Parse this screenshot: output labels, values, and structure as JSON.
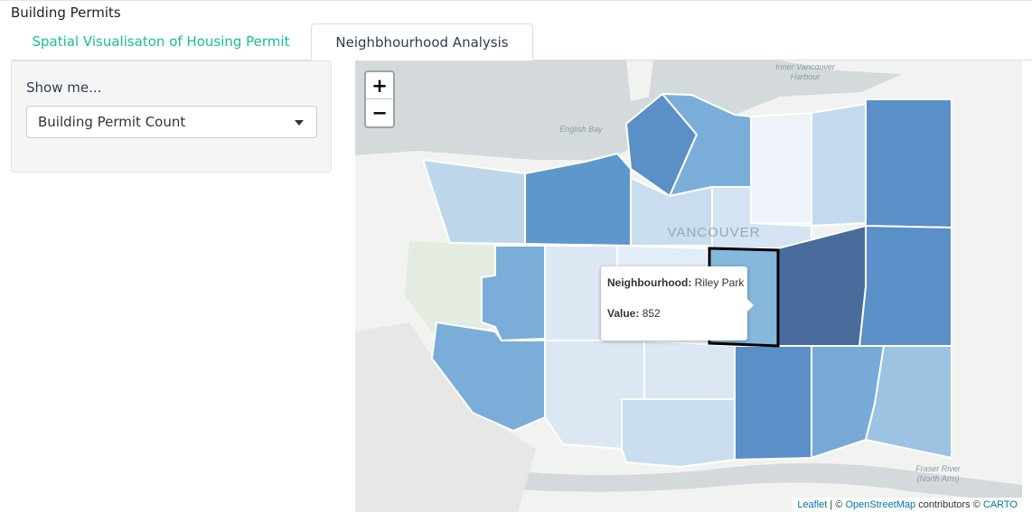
{
  "app": {
    "title": "Building Permits"
  },
  "tabs": [
    {
      "label": "Spatial Visualisaton of Housing Permit",
      "active": false
    },
    {
      "label": "Neighbhourhood Analysis",
      "active": true
    }
  ],
  "sidebar": {
    "show_label": "Show me...",
    "select": {
      "value": "Building Permit Count"
    }
  },
  "map": {
    "zoom_in": "+",
    "zoom_out": "−",
    "place_labels": [
      "Inner Vancouver",
      "Harbour",
      "English Bay",
      "VANCOUVER",
      "Fraser River",
      "(North Arm)"
    ],
    "popup": {
      "neighbourhood_label": "Neighbourhood:",
      "neighbourhood_value": "Riley Park",
      "value_label": "Value:",
      "value": "852"
    },
    "attribution": {
      "leaflet": "Leaflet",
      "sep": " | © ",
      "osm": "OpenStreetMap",
      "mid": " contributors © ",
      "carto": "CARTO"
    },
    "colors": {
      "water": "#d4dadc",
      "land": "#f2f2f0",
      "choropleth_darkest": "#4a6c9c",
      "choropleth_lightest": "#eef3f9",
      "highlight_border": "#000000"
    }
  }
}
